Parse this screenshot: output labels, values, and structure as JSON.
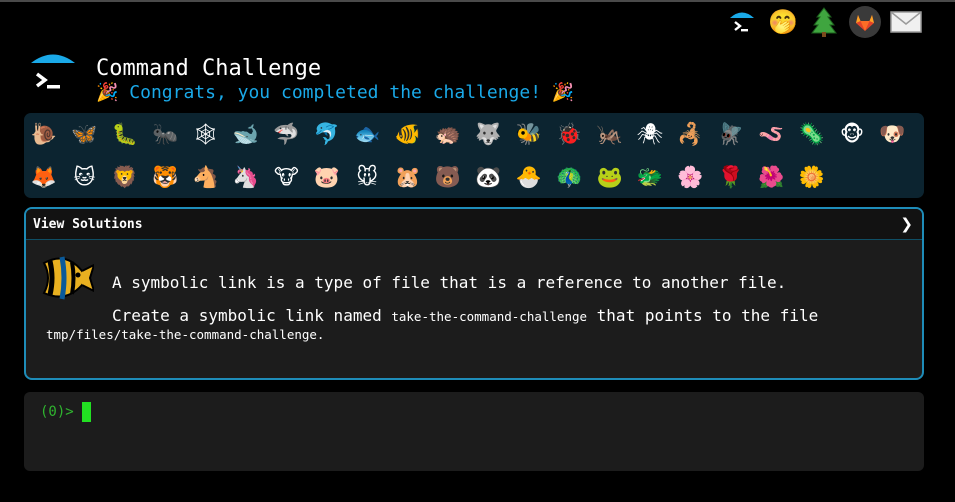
{
  "header": {
    "title": "Command Challenge",
    "subtitle_emoji_left": "🎉",
    "subtitle": "Congrats, you completed the challenge!",
    "subtitle_emoji_right": "🎉",
    "logo_icon": "terminal-prompt-icon"
  },
  "topnav": {
    "items": [
      {
        "name": "command-challenge-icon",
        "glyph": ""
      },
      {
        "name": "hand-over-mouth-emoji-icon",
        "glyph": "🤭"
      },
      {
        "name": "evergreen-tree-icon",
        "glyph": "🌲"
      },
      {
        "name": "gitlab-icon",
        "glyph": ""
      },
      {
        "name": "envelope-icon",
        "glyph": "✉"
      }
    ]
  },
  "animals": {
    "row1": [
      "🐌",
      "🦋",
      "🐛",
      "🐜",
      "🕸",
      "🐋",
      "🦈",
      "🐬",
      "🐟",
      "🐠",
      "🦔",
      "🐺",
      "🐝",
      "🐞",
      "🦗",
      "🕷",
      "🦂",
      "🪰",
      "🪱",
      "🦠",
      "🐵",
      "🐶"
    ],
    "row2": [
      "🦊",
      "🐱",
      "🦁",
      "🐯",
      "🐴",
      "🦄",
      "🐮",
      "🐷",
      "🐭",
      "🐹",
      "🐻",
      "🐼",
      "🐣",
      "🦚",
      "🐸",
      "🐲",
      "🌸",
      "🌹",
      "🌺",
      "🌼"
    ]
  },
  "solutions": {
    "header_label": "View Solutions",
    "chevron": "❯",
    "fish_icon": "tropical-fish-icon",
    "line1": "A symbolic link is a type of file that is a reference to another file.",
    "line2_prefix": "Create a symbolic link named ",
    "line2_code": "take-the-command-challenge",
    "line2_suffix": " that points to the file",
    "line3": "tmp/files/take-the-command-challenge."
  },
  "terminal": {
    "prompt": "(0)>"
  },
  "colors": {
    "background": "#000000",
    "subtitle": "#1aa9e8",
    "panel": "#0c2430",
    "card_border": "#1e8cb8",
    "prompt": "#2fb52f",
    "cursor": "#22e022"
  }
}
